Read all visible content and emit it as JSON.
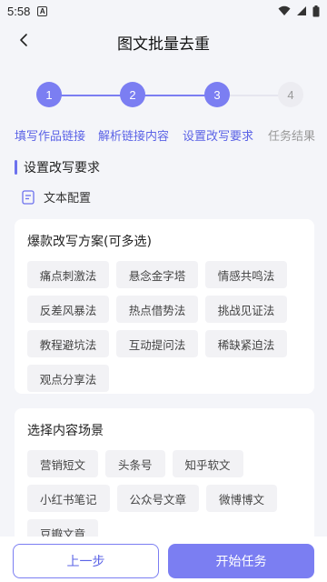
{
  "status_bar": {
    "time": "5:58",
    "notif_letter": "A"
  },
  "header": {
    "title": "图文批量去重"
  },
  "stepper": {
    "steps": [
      {
        "number": "1",
        "label": "填写作品链接",
        "active": true
      },
      {
        "number": "2",
        "label": "解析链接内容",
        "active": true
      },
      {
        "number": "3",
        "label": "设置改写要求",
        "active": true
      },
      {
        "number": "4",
        "label": "任务结果",
        "active": false
      }
    ]
  },
  "section": {
    "title": "设置改写要求",
    "config_label": "文本配置"
  },
  "rewrite_card": {
    "title": "爆款改写方案(可多选)",
    "options": [
      "痛点刺激法",
      "悬念金字塔",
      "情感共鸣法",
      "反差风暴法",
      "热点借势法",
      "挑战见证法",
      "教程避坑法",
      "互动提问法",
      "稀缺紧迫法",
      "观点分享法"
    ]
  },
  "scene_card": {
    "title": "选择内容场景",
    "options": [
      "营销短文",
      "头条号",
      "知乎软文",
      "小红书笔记",
      "公众号文章",
      "微博博文",
      "豆瓣文章"
    ]
  },
  "footer": {
    "prev_label": "上一步",
    "start_label": "开始任务"
  },
  "colors": {
    "accent": "#7b7ef2",
    "accent_text": "#5b63e6",
    "inactive": "#ececf1"
  }
}
